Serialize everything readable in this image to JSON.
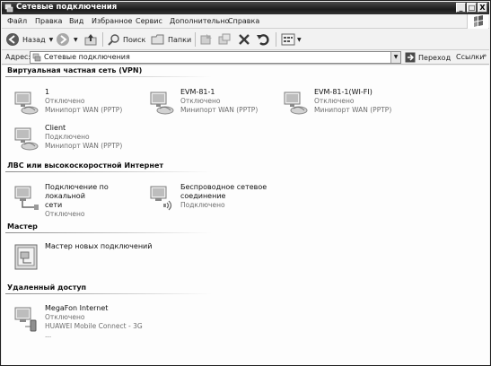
{
  "window": {
    "title": "Сетевые подключения",
    "controls": {
      "minimize": "_",
      "maximize": "□",
      "close": "X"
    }
  },
  "menu": [
    "Файл",
    "Правка",
    "Вид",
    "Избранное",
    "Сервис",
    "Дополнительно",
    "Справка"
  ],
  "toolbar": {
    "back": "Назад",
    "search": "Поиск",
    "folders": "Папки"
  },
  "address": {
    "label": "Адрес:",
    "value": "Сетевые подключения",
    "go": "Переход",
    "links": "Ссылки",
    "links_arrow": "»"
  },
  "groups": {
    "vpn": {
      "title": "Виртуальная частная сеть (VPN)",
      "items": [
        {
          "name": "1",
          "status": "Отключено",
          "device": "Минипорт WAN (PPTP)"
        },
        {
          "name": "EVM-81-1",
          "status": "Отключено",
          "device": "Минипорт WAN (PPTP)"
        },
        {
          "name": "EVM-81-1(WI-FI)",
          "status": "Отключено",
          "device": "Минипорт WAN (PPTP)"
        },
        {
          "name": "Client",
          "status": "Подключено",
          "device": "Минипорт WAN (PPTP)"
        }
      ]
    },
    "lan": {
      "title": "ЛВС или высокоскоростной Интернет",
      "items": [
        {
          "name_line1": "Подключение по локальной",
          "name_line2": "сети",
          "status": "Отключено"
        },
        {
          "name_line1": "Беспроводное сетевое",
          "name_line2": "соединение",
          "status": "Подключено"
        }
      ]
    },
    "wizard": {
      "title": "Мастер",
      "items": [
        {
          "name": "Мастер новых подключений"
        }
      ]
    },
    "dialup": {
      "title": "Удаленный доступ",
      "items": [
        {
          "name": "MegaFon Internet",
          "status": "Отключено",
          "device": "HUAWEI Mobile Connect - 3G ..."
        }
      ]
    }
  }
}
